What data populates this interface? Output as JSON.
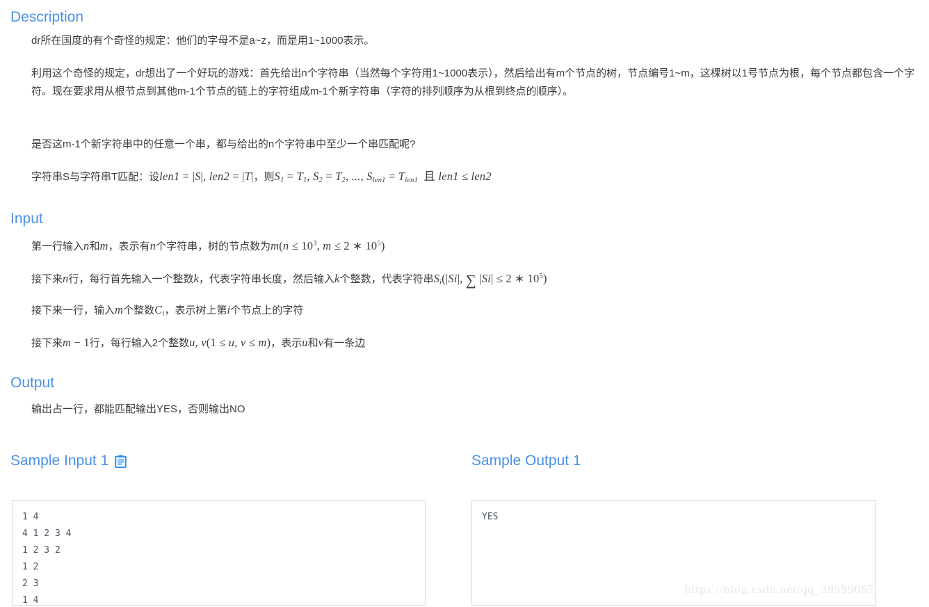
{
  "sections": {
    "description": {
      "heading": "Description",
      "p1": "dr所在国度的有个奇怪的规定：他们的字母不是a~z，而是用1~1000表示。",
      "p2": "利用这个奇怪的规定，dr想出了一个好玩的游戏：首先给出n个字符串（当然每个字符用1~1000表示），然后给出有m个节点的树，节点编号1~m，这棵树以1号节点为根，每个节点都包含一个字符。现在要求用从根节点到其他m-1个节点的链上的字符组成m-1个新字符串（字符的排列顺序为从根到终点的顺序）。",
      "p3": "是否这m-1个新字符串中的任意一个串，都与给出的n个字符串中至少一个串匹配呢?",
      "p4_prefix": "字符串S与字符串T匹配：设",
      "p4_math": "len1 = |S|, len2 = |T|",
      "p4_mid": "，则",
      "p4_math2": "S1 = T1, S2 = T2, ..., Slen1 = Tlen1 且 len1 ≤ len2"
    },
    "input": {
      "heading": "Input",
      "p1_prefix": "第一行输入",
      "p1_n": "n",
      "p1_and": "和",
      "p1_m": "m",
      "p1_mid": "，表示有",
      "p1_n2": "n",
      "p1_mid2": "个字符串，树的节点数为",
      "p1_math": "m(n ≤ 10^3, m ≤ 2 * 10^5)",
      "p2_prefix": "接下来",
      "p2_n": "n",
      "p2_mid": "行，每行首先输入一个整数",
      "p2_k": "k",
      "p2_mid2": "，代表字符串长度，然后输入",
      "p2_k2": "k",
      "p2_mid3": "个整数，代表字符串",
      "p2_math": "Si(|Si|, ∑|Si| ≤ 2 * 10^5)",
      "p3_prefix": "接下来一行，输入",
      "p3_m": "m",
      "p3_mid": "个整数",
      "p3_c": "Ci",
      "p3_mid2": "，表示树上第",
      "p3_i": "i",
      "p3_suffix": "个节点上的字符",
      "p4_prefix": "接下来",
      "p4_math": "m − 1",
      "p4_mid": "行，每行输入2个整数",
      "p4_math2": "u, v(1 ≤ u, v ≤ m)",
      "p4_mid2": "，表示",
      "p4_u": "u",
      "p4_and": "和",
      "p4_v": "v",
      "p4_suffix": "有一条边"
    },
    "output": {
      "heading": "Output",
      "p1": "输出占一行，都能匹配输出YES，否则输出NO"
    },
    "sample_input": {
      "title": "Sample Input 1",
      "copy_icon": "clipboard-icon",
      "content": "1 4\n4 1 2 3 4\n1 2 3 2\n1 2\n2 3\n1 4"
    },
    "sample_output": {
      "title": "Sample Output 1",
      "content": "YES"
    }
  },
  "watermark": "https://blog.csdn.net/qq_39599067",
  "colors": {
    "heading": "#4a90e8",
    "body": "#3d3d3d",
    "code": "#4b5665",
    "box_border": "#dcdcdc",
    "watermark": "#e7e7e7"
  }
}
